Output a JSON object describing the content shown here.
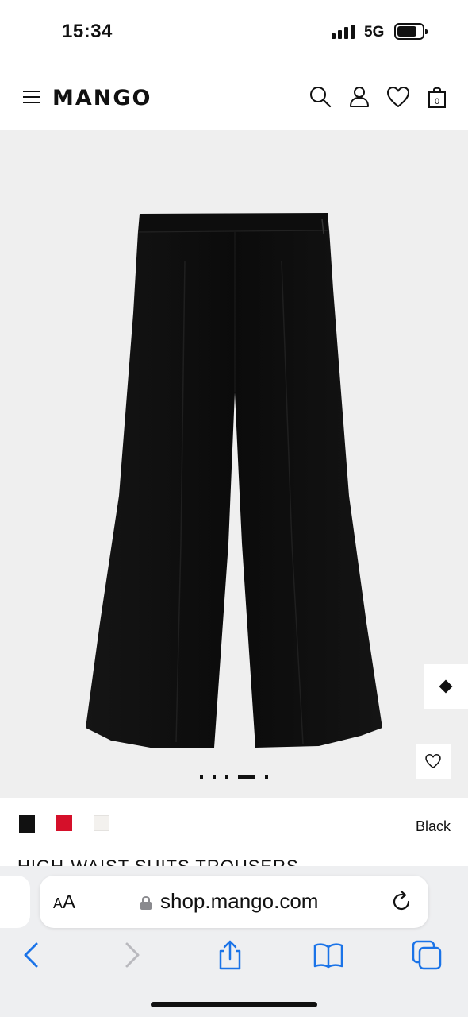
{
  "status_bar": {
    "time": "15:34",
    "network": "5G",
    "signal_bars": 4,
    "battery_level": 0.75
  },
  "header": {
    "logo": "MANGO",
    "menu_icon": "hamburger-menu-icon",
    "icons": [
      "search-icon",
      "user-icon",
      "heart-icon",
      "shopping-bag-icon"
    ],
    "bag_count": "0"
  },
  "product": {
    "image_background": "#efefef",
    "garment_color": "#0c0c0c",
    "carousel_slide_count": 5,
    "carousel_active_index": 3,
    "side_button_icon": "diamond-icon",
    "wishlist_icon": "heart-icon",
    "title_partial": "HIGH-WAIST SUITS TROUSERS"
  },
  "colors": {
    "swatches": [
      {
        "name": "black-swatch",
        "hex": "#111111"
      },
      {
        "name": "red-swatch",
        "hex": "#d5102a"
      },
      {
        "name": "white-swatch",
        "hex": "#f3f1ee"
      }
    ],
    "selected_index": 0,
    "selected_label": "Black"
  },
  "browser": {
    "text_size_label": "AA",
    "url": "shop.mango.com",
    "toolbar_icons": [
      "back-icon",
      "forward-icon",
      "share-icon",
      "bookmarks-icon",
      "tabs-icon"
    ]
  }
}
